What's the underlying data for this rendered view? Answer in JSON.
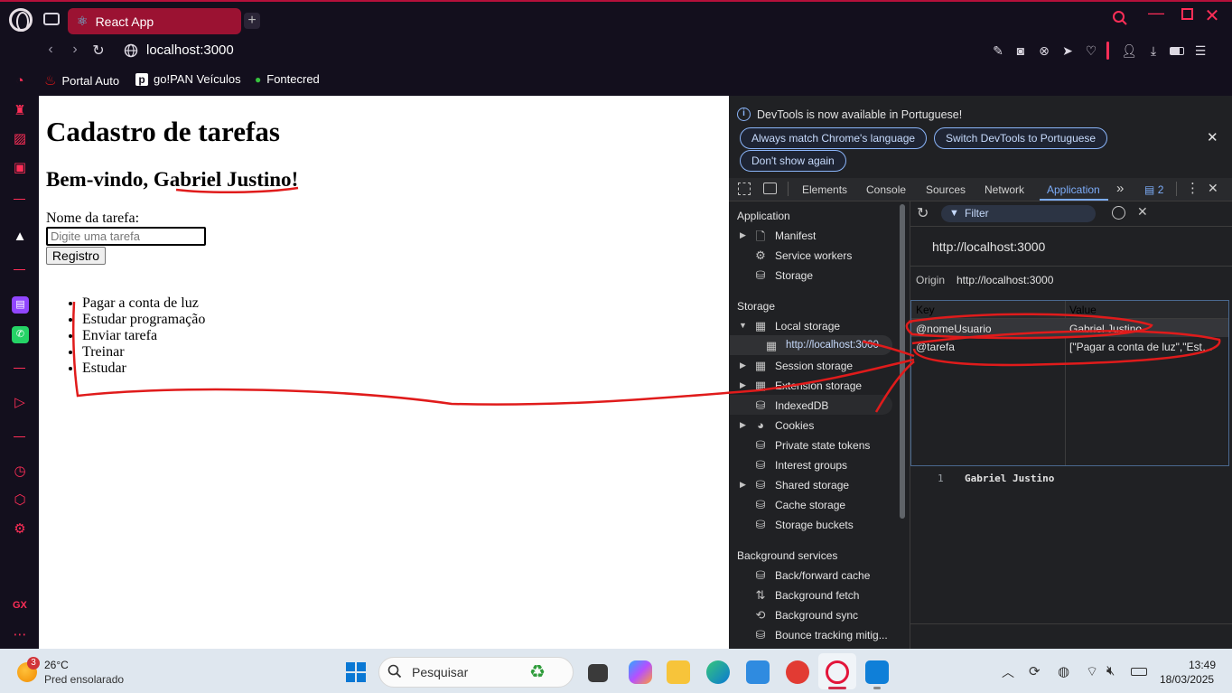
{
  "browser": {
    "tab_title": "React App",
    "new_tab_symbol": "+",
    "url": "localhost:3000",
    "bookmarks": [
      {
        "label": "Portal Auto",
        "icon": "santander-flame-icon",
        "color": "#e31919"
      },
      {
        "label": "go!PAN Veículos",
        "icon": "pan-p-icon",
        "color": "#ffffff"
      },
      {
        "label": "Fontecred",
        "icon": "green-dot-icon",
        "color": "#37c23e"
      }
    ],
    "sidebar_footer": "GX",
    "accent_color": "#ff2e57"
  },
  "page": {
    "title": "Cadastro de tarefas",
    "welcome_prefix": "Bem-vindo, ",
    "user_name": "Gabriel Justino",
    "welcome_suffix": "!",
    "task_label": "Nome da tarefa:",
    "task_placeholder": "Digite uma tarefa",
    "register_button": "Registro",
    "tasks": [
      "Pagar a conta de luz",
      "Estudar programação",
      "Enviar tarefa",
      "Treinar",
      "Estudar"
    ]
  },
  "devtools": {
    "info_message": "DevTools is now available in Portuguese!",
    "btn_match_language": "Always match Chrome's language",
    "btn_switch": "Switch DevTools to Portuguese",
    "btn_dont_show": "Don't show again",
    "tabs": [
      "Elements",
      "Console",
      "Sources",
      "Network",
      "Application"
    ],
    "active_tab": "Application",
    "issues_count": "2",
    "sidebar": {
      "application_header": "Application",
      "application_items": [
        "Manifest",
        "Service workers",
        "Storage"
      ],
      "storage_header": "Storage",
      "local_storage": "Local storage",
      "local_storage_origin": "http://localhost:3000",
      "storage_items": [
        "Session storage",
        "Extension storage",
        "IndexedDB",
        "Cookies",
        "Private state tokens",
        "Interest groups",
        "Shared storage",
        "Cache storage",
        "Storage buckets"
      ],
      "background_header": "Background services",
      "background_items": [
        "Back/forward cache",
        "Background fetch",
        "Background sync",
        "Bounce tracking mitig..."
      ]
    },
    "filter_placeholder": "Filter",
    "origin_heading": "http://localhost:3000",
    "origin_label": "Origin",
    "origin_value": "http://localhost:3000",
    "table_headers": [
      "Key",
      "Value"
    ],
    "rows": [
      {
        "key": "@nomeUsuario",
        "value": "Gabriel Justino"
      },
      {
        "key": "@tarefa",
        "value": "[\"Pagar a conta de luz\",\"Estudar programação\",\"Enviar tarefa\",\"Treinar\",\"Estudar\"]"
      }
    ],
    "preview_line_number": "1",
    "preview_value": "Gabriel Justino"
  },
  "taskbar": {
    "weather_badge": "3",
    "temperature": "26°C",
    "weather_desc": "Pred ensolarado",
    "search_placeholder": "Pesquisar",
    "time": "13:49",
    "date": "18/03/2025"
  }
}
